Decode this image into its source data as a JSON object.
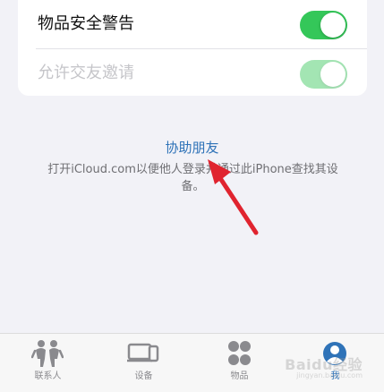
{
  "settings": {
    "item_safety_alert": {
      "label": "物品安全警告",
      "enabled": true,
      "disabled": false
    },
    "allow_friend_request": {
      "label": "允许交友邀请",
      "enabled": true,
      "disabled": true
    }
  },
  "help": {
    "link_label": "协助朋友",
    "description": "打开iCloud.com以便他人登录并通过此iPhone查找其设备。"
  },
  "tabbar": {
    "tabs": [
      {
        "label": "联系人",
        "icon": "people-icon",
        "active": false
      },
      {
        "label": "设备",
        "icon": "devices-icon",
        "active": false
      },
      {
        "label": "物品",
        "icon": "items-icon",
        "active": false
      },
      {
        "label": "我",
        "icon": "me-icon",
        "active": true
      }
    ]
  },
  "watermark": {
    "text": "Baidu经验",
    "sub": "jingyan.baidu.com"
  },
  "colors": {
    "accent": "#2f73b8",
    "toggle_on": "#34c759",
    "annotation": "#e0242f"
  }
}
